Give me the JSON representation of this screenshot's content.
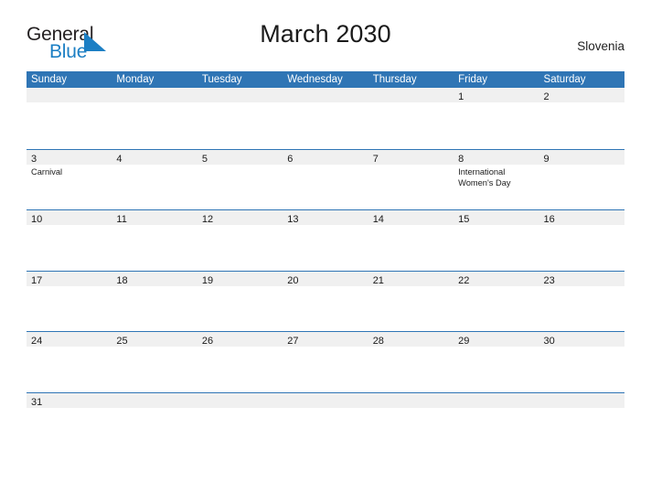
{
  "brand": {
    "name_part1": "General",
    "name_part2": "Blue",
    "triangle_color": "#1c7fc4",
    "text_color": "#231f20"
  },
  "header": {
    "title": "March 2030",
    "region": "Slovenia"
  },
  "theme": {
    "header_blue": "#2f75b5",
    "date_band_gray": "#f0f0f0",
    "page_background": "#ffffff",
    "text_color": "#1a1a1a"
  },
  "calendar": {
    "weekdays": [
      "Sunday",
      "Monday",
      "Tuesday",
      "Wednesday",
      "Thursday",
      "Friday",
      "Saturday"
    ],
    "weeks": [
      [
        {
          "day": "",
          "events": []
        },
        {
          "day": "",
          "events": []
        },
        {
          "day": "",
          "events": []
        },
        {
          "day": "",
          "events": []
        },
        {
          "day": "",
          "events": []
        },
        {
          "day": "1",
          "events": []
        },
        {
          "day": "2",
          "events": []
        }
      ],
      [
        {
          "day": "3",
          "events": [
            "Carnival"
          ]
        },
        {
          "day": "4",
          "events": []
        },
        {
          "day": "5",
          "events": []
        },
        {
          "day": "6",
          "events": []
        },
        {
          "day": "7",
          "events": []
        },
        {
          "day": "8",
          "events": [
            "International Women's Day"
          ]
        },
        {
          "day": "9",
          "events": []
        }
      ],
      [
        {
          "day": "10",
          "events": []
        },
        {
          "day": "11",
          "events": []
        },
        {
          "day": "12",
          "events": []
        },
        {
          "day": "13",
          "events": []
        },
        {
          "day": "14",
          "events": []
        },
        {
          "day": "15",
          "events": []
        },
        {
          "day": "16",
          "events": []
        }
      ],
      [
        {
          "day": "17",
          "events": []
        },
        {
          "day": "18",
          "events": []
        },
        {
          "day": "19",
          "events": []
        },
        {
          "day": "20",
          "events": []
        },
        {
          "day": "21",
          "events": []
        },
        {
          "day": "22",
          "events": []
        },
        {
          "day": "23",
          "events": []
        }
      ],
      [
        {
          "day": "24",
          "events": []
        },
        {
          "day": "25",
          "events": []
        },
        {
          "day": "26",
          "events": []
        },
        {
          "day": "27",
          "events": []
        },
        {
          "day": "28",
          "events": []
        },
        {
          "day": "29",
          "events": []
        },
        {
          "day": "30",
          "events": []
        }
      ],
      [
        {
          "day": "31",
          "events": []
        },
        {
          "day": "",
          "events": []
        },
        {
          "day": "",
          "events": []
        },
        {
          "day": "",
          "events": []
        },
        {
          "day": "",
          "events": []
        },
        {
          "day": "",
          "events": []
        },
        {
          "day": "",
          "events": []
        }
      ]
    ]
  }
}
